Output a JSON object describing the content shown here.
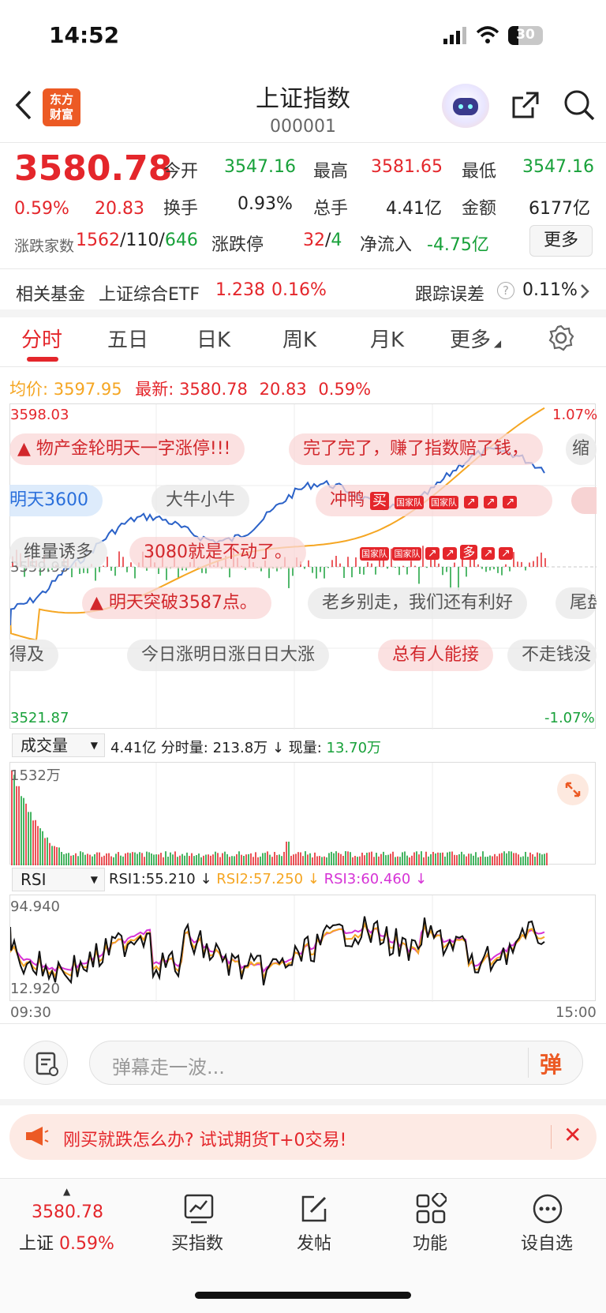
{
  "status_bar": {
    "time": "14:52",
    "battery": "30"
  },
  "header": {
    "logo_line1": "东方",
    "logo_line2": "财富",
    "title": "上证指数",
    "code": "000001"
  },
  "quote": {
    "price": "3580.78",
    "change_pct": "0.59%",
    "change": "20.83",
    "open_label": "今开",
    "open": "3547.16",
    "high_label": "最高",
    "high": "3581.65",
    "low_label": "最低",
    "low": "3547.16",
    "turnover_label": "换手",
    "turnover": "0.93%",
    "volume_label": "总手",
    "volume": "4.41亿",
    "amount_label": "金额",
    "amount": "6177亿",
    "breadth_label": "涨跌家数",
    "up": "1562",
    "flat": "110",
    "down": "646",
    "limit_label": "涨跌停",
    "limit_up": "32",
    "limit_down": "4",
    "netflow_label": "净流入",
    "netflow": "-4.75亿",
    "more": "更多"
  },
  "fund": {
    "label": "相关基金",
    "name": "上证综合ETF",
    "price": "1.238",
    "pct": "0.16%",
    "track_label": "跟踪误差",
    "track": "0.11%"
  },
  "tabs": [
    "分时",
    "五日",
    "日K",
    "周K",
    "月K",
    "更多"
  ],
  "chart_info": {
    "avg_label": "均价:",
    "avg": "3597.95",
    "last_label": "最新:",
    "last": "3580.78",
    "chg": "20.83",
    "pct": "0.59%"
  },
  "axis": {
    "top": "3598.03",
    "mid": "3559.95",
    "bottom": "3521.87",
    "top_pct": "1.07%",
    "bottom_pct": "-1.07%",
    "start_time": "09:30",
    "end_time": "15:00"
  },
  "danmu": [
    "物产金轮明天一字涨停!!!",
    "完了完了，赚了指数赔了钱，",
    "缩",
    "明天3600",
    "大牛小牛",
    "冲鸭",
    "维量诱多",
    "3080就是不动了。",
    "明天突破3587点。",
    "老乡别走，我们还有利好",
    "尾盘",
    "得及",
    "今日涨明日涨日日大涨",
    "总有人能接",
    "不走钱没"
  ],
  "badges": {
    "buy": "买",
    "team": "国家队",
    "many": "多"
  },
  "volume": {
    "select": "成交量",
    "total": "4.41亿",
    "period_label": "分时量:",
    "period": "213.8万",
    "now_label": "现量:",
    "now": "13.70万",
    "max": "1532万"
  },
  "rsi": {
    "select": "RSI",
    "rsi1": "RSI1:55.210",
    "rsi2": "RSI2:57.250",
    "rsi3": "RSI3:60.460",
    "max": "94.940",
    "min": "12.920"
  },
  "comment": {
    "placeholder": "弹幕走一波...",
    "danmu_btn": "弹"
  },
  "banner": {
    "text": "刚买就跌怎么办? 试试期货T+0交易!"
  },
  "bottom_nav": {
    "index_price": "3580.78",
    "index_name": "上证",
    "index_pct": "0.59%",
    "items": [
      "买指数",
      "发帖",
      "功能",
      "设自选"
    ]
  },
  "colors": {
    "red": "#e4262b",
    "green": "#18a13a",
    "price_line": "#2b62c8",
    "avg_line": "#f5a623",
    "rsi3": "#d633d6"
  }
}
